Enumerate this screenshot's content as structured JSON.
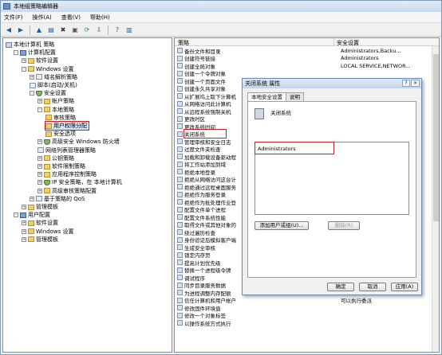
{
  "window": {
    "title": "本地组策略编辑器"
  },
  "menu": [
    "文件(F)",
    "操作(A)",
    "查看(V)",
    "帮助(H)"
  ],
  "toolbar_icons": [
    "back-icon",
    "forward-icon",
    "up-icon",
    "show-hide-tree-icon",
    "delete-icon",
    "properties-icon",
    "refresh-icon",
    "export-icon",
    "help-icon",
    "view-icon"
  ],
  "tree": [
    {
      "label": "本地计算机 策略",
      "level": 0,
      "icon": "root",
      "exp": ""
    },
    {
      "label": "计算机配置",
      "level": 1,
      "icon": "comp",
      "exp": "-"
    },
    {
      "label": "软件设置",
      "level": 2,
      "icon": "folder",
      "exp": "+"
    },
    {
      "label": "Windows 设置",
      "level": 2,
      "icon": "folder",
      "exp": "-"
    },
    {
      "label": "域名解析策略",
      "level": 3,
      "icon": "doc",
      "exp": "+"
    },
    {
      "label": "脚本(启动/关机)",
      "level": 3,
      "icon": "doc",
      "exp": ""
    },
    {
      "label": "安全设置",
      "level": 3,
      "icon": "shield",
      "exp": "-"
    },
    {
      "label": "帐户策略",
      "level": 4,
      "icon": "folder",
      "exp": "+"
    },
    {
      "label": "本地策略",
      "level": 4,
      "icon": "folder",
      "exp": "-"
    },
    {
      "label": "审核策略",
      "level": 5,
      "icon": "folder",
      "exp": ""
    },
    {
      "label": "用户权限分配",
      "level": 5,
      "icon": "folder",
      "exp": "",
      "selected": true
    },
    {
      "label": "安全选项",
      "level": 5,
      "icon": "folder",
      "exp": ""
    },
    {
      "label": "高级安全 Windows 防火墙",
      "level": 4,
      "icon": "shield",
      "exp": "+"
    },
    {
      "label": "网络列表管理器策略",
      "level": 4,
      "icon": "doc",
      "exp": ""
    },
    {
      "label": "公钥策略",
      "level": 4,
      "icon": "folder",
      "exp": "+"
    },
    {
      "label": "软件限制策略",
      "level": 4,
      "icon": "folder",
      "exp": "+"
    },
    {
      "label": "应用程序控制策略",
      "level": 4,
      "icon": "folder",
      "exp": "+"
    },
    {
      "label": "IP 安全策略，在 本地计算机",
      "level": 4,
      "icon": "shield",
      "exp": "+"
    },
    {
      "label": "高级审核策略配置",
      "level": 4,
      "icon": "folder",
      "exp": "+"
    },
    {
      "label": "基于策略的 QoS",
      "level": 3,
      "icon": "doc",
      "exp": "+"
    },
    {
      "label": "管理模板",
      "level": 2,
      "icon": "folder",
      "exp": "+"
    },
    {
      "label": "用户配置",
      "level": 1,
      "icon": "comp",
      "exp": "-"
    },
    {
      "label": "软件设置",
      "level": 2,
      "icon": "folder",
      "exp": "+"
    },
    {
      "label": "Windows 设置",
      "level": 2,
      "icon": "folder",
      "exp": "+"
    },
    {
      "label": "管理模板",
      "level": 2,
      "icon": "folder",
      "exp": "+"
    }
  ],
  "list": {
    "columns": [
      "策略",
      "安全设置"
    ],
    "rows": [
      {
        "name": "备份文件和目录",
        "val": "Administrators,Backu..."
      },
      {
        "name": "创建符号链接",
        "val": "Administrators"
      },
      {
        "name": "创建全局对象",
        "val": "LOCAL SERVICE,NETWOR..."
      },
      {
        "name": "创建一个令牌对象",
        "val": ""
      },
      {
        "name": "创建一个页面文件",
        "val": ""
      },
      {
        "name": "创建永久共享对象",
        "val": ""
      },
      {
        "name": "从扩展坞上取下计算机",
        "val": ""
      },
      {
        "name": "从网络访问此计算机",
        "val": ""
      },
      {
        "name": "从远程系统强制关机",
        "val": ""
      },
      {
        "name": "更改时区",
        "val": ""
      },
      {
        "name": "更改系统时间",
        "val": ""
      },
      {
        "name": "关闭系统",
        "val": "",
        "hl": true
      },
      {
        "name": "管理审核和安全日志",
        "val": ""
      },
      {
        "name": "过度文件夹检查",
        "val": ""
      },
      {
        "name": "加载和卸载设备驱动程",
        "val": ""
      },
      {
        "name": "将工作站添加到域",
        "val": ""
      },
      {
        "name": "拒绝本地登录",
        "val": ""
      },
      {
        "name": "拒绝从网络访问这台计",
        "val": ""
      },
      {
        "name": "拒绝通过远程桌面服务",
        "val": ""
      },
      {
        "name": "拒绝作为服务登录",
        "val": ""
      },
      {
        "name": "拒绝作为批处理作业登",
        "val": ""
      },
      {
        "name": "配置文件单个进程",
        "val": ""
      },
      {
        "name": "配置文件系统性能",
        "val": ""
      },
      {
        "name": "取得文件或其他对象的",
        "val": ""
      },
      {
        "name": "绕过遍历检查",
        "val": ""
      },
      {
        "name": "身份验证后模拟客户端",
        "val": ""
      },
      {
        "name": "生成安全审核",
        "val": ""
      },
      {
        "name": "锁定内存页",
        "val": ""
      },
      {
        "name": "提高计划优先级",
        "val": ""
      },
      {
        "name": "替换一个进程级令牌",
        "val": ""
      },
      {
        "name": "调试程序",
        "val": ""
      },
      {
        "name": "同步目录服务数据",
        "val": ""
      },
      {
        "name": "为进程调整内存配额",
        "val": ""
      },
      {
        "name": "信任计算机和用户帐户",
        "val": "可以执行委派"
      },
      {
        "name": "修改固件环境值",
        "val": ""
      },
      {
        "name": "修改一个对象标签",
        "val": ""
      },
      {
        "name": "以操作系统方式执行",
        "val": ""
      }
    ],
    "row_extra": "可以执行委派"
  },
  "dialog": {
    "title": "关闭系统 属性",
    "help": "?",
    "close": "×",
    "tabs": [
      "本地安全设置",
      "说明"
    ],
    "policy_name": "关闭系统",
    "users": [
      "Administrators"
    ],
    "add_button": "添加用户或组(U)...",
    "remove_button": "删除(R)",
    "ok": "确定",
    "cancel": "取消",
    "apply": "应用(A)"
  }
}
